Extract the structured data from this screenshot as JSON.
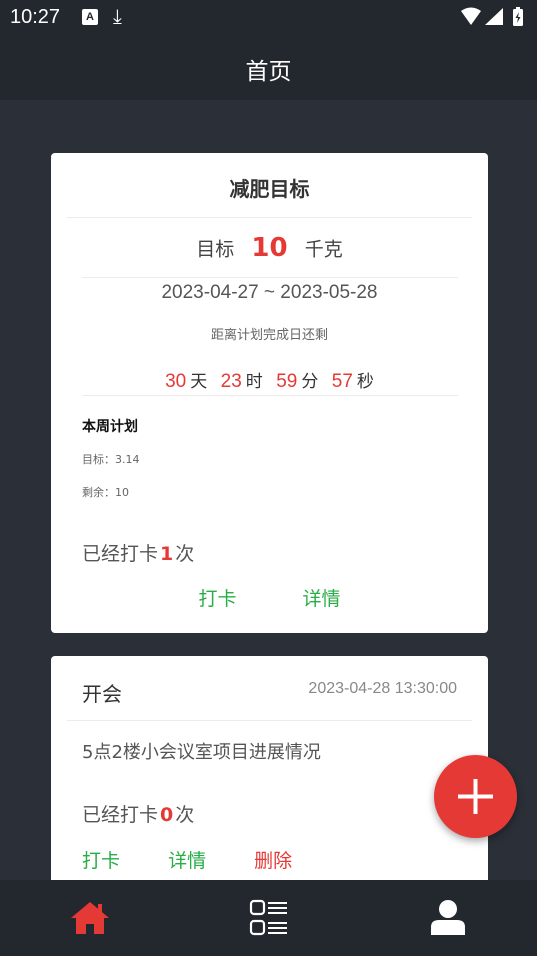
{
  "status_bar": {
    "time": "10:27",
    "notification_badge": "A",
    "download_glyph": "⤓",
    "icons": [
      "a-notification-icon",
      "download-icon",
      "wifi-icon",
      "cellular-icon",
      "battery-charging-icon"
    ]
  },
  "app_bar": {
    "title": "首页"
  },
  "goal_card": {
    "title": "减肥目标",
    "target_label": "目标",
    "target_value": "10",
    "target_unit": "千克",
    "date_range": "2023-04-27 ~ 2023-05-28",
    "remaining_label": "距离计划完成日还剩",
    "countdown": {
      "days": "30",
      "days_unit": "天",
      "hours": "23",
      "hours_unit": "时",
      "minutes": "59",
      "minutes_unit": "分",
      "seconds": "57",
      "seconds_unit": "秒"
    },
    "week_plan": {
      "title": "本周计划",
      "goal_text": "目标：3.14",
      "remaining_text": "剩余：10"
    },
    "checked_prefix": "已经打卡",
    "checked_count": "1",
    "checked_suffix": "次",
    "actions": {
      "checkin": "打卡",
      "details": "详情"
    }
  },
  "meeting_card": {
    "title": "开会",
    "datetime": "2023-04-28 13:30:00",
    "description": "5点2楼小会议室项目进展情况",
    "checked_prefix": "已经打卡",
    "checked_count": "0",
    "checked_suffix": "次",
    "actions": {
      "checkin": "打卡",
      "details": "详情",
      "delete": "删除"
    }
  },
  "fab": {
    "icon": "plus-icon"
  },
  "bottom_nav": {
    "items": [
      {
        "name": "home",
        "icon": "home-icon",
        "active": true
      },
      {
        "name": "list",
        "icon": "list-icon",
        "active": false
      },
      {
        "name": "profile",
        "icon": "user-icon",
        "active": false
      }
    ]
  },
  "colors": {
    "accent_red": "#e53935",
    "action_green": "#27ae46",
    "bar_bg": "#23272e",
    "page_bg": "#2a2f38"
  }
}
